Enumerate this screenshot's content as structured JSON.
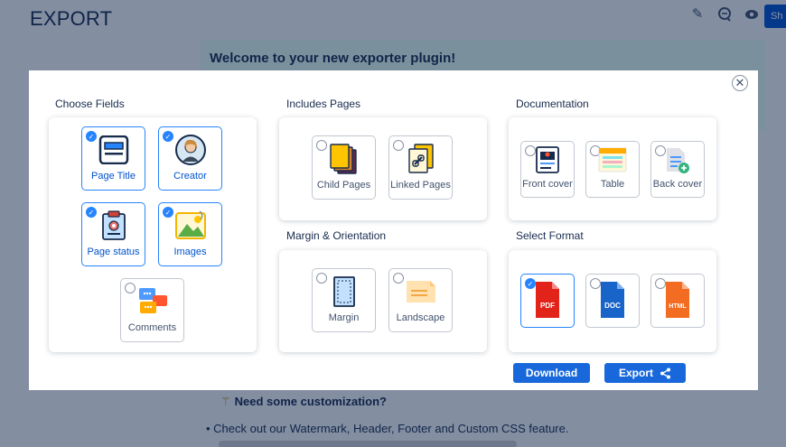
{
  "page": {
    "title": "EXPORT",
    "share_label": "Sh",
    "welcome": "Welcome to your new exporter plugin!",
    "customization": "Need some customization?",
    "bullet": "• Check out our Watermark, Header, Footer and Custom CSS feature."
  },
  "icons": {
    "edit": "pencil-icon",
    "comment": "comment-icon",
    "watch": "eye-icon",
    "wand": "magic-wand-icon",
    "close": "close-icon",
    "share": "share-icon"
  },
  "colors": {
    "accent": "#2684ff",
    "button": "#1868db",
    "welcome_bg": "#e3fcef"
  },
  "modal": {
    "close_label": "✕",
    "fields": {
      "title": "Choose Fields",
      "items": [
        {
          "label": "Page Title",
          "checked": true
        },
        {
          "label": "Creator",
          "checked": true
        },
        {
          "label": "Page status",
          "checked": true
        },
        {
          "label": "Images",
          "checked": true
        },
        {
          "label": "Comments",
          "checked": false
        }
      ]
    },
    "pages": {
      "title": "Includes Pages",
      "items": [
        {
          "label": "Child Pages",
          "checked": false
        },
        {
          "label": "Linked Pages",
          "checked": false
        }
      ]
    },
    "margin": {
      "title": "Margin & Orientation",
      "items": [
        {
          "label": "Margin",
          "checked": false
        },
        {
          "label": "Landscape",
          "checked": false
        }
      ]
    },
    "docs": {
      "title": "Documentation",
      "items": [
        {
          "label": "Front cover",
          "checked": false
        },
        {
          "label": "Table",
          "checked": false
        },
        {
          "label": "Back cover",
          "checked": false
        }
      ]
    },
    "format": {
      "title": "Select Format",
      "items": [
        {
          "label": "PDF",
          "checked": true
        },
        {
          "label": "DOC",
          "checked": false
        },
        {
          "label": "HTML",
          "checked": false
        }
      ]
    },
    "download_label": "Download",
    "export_label": "Export"
  }
}
